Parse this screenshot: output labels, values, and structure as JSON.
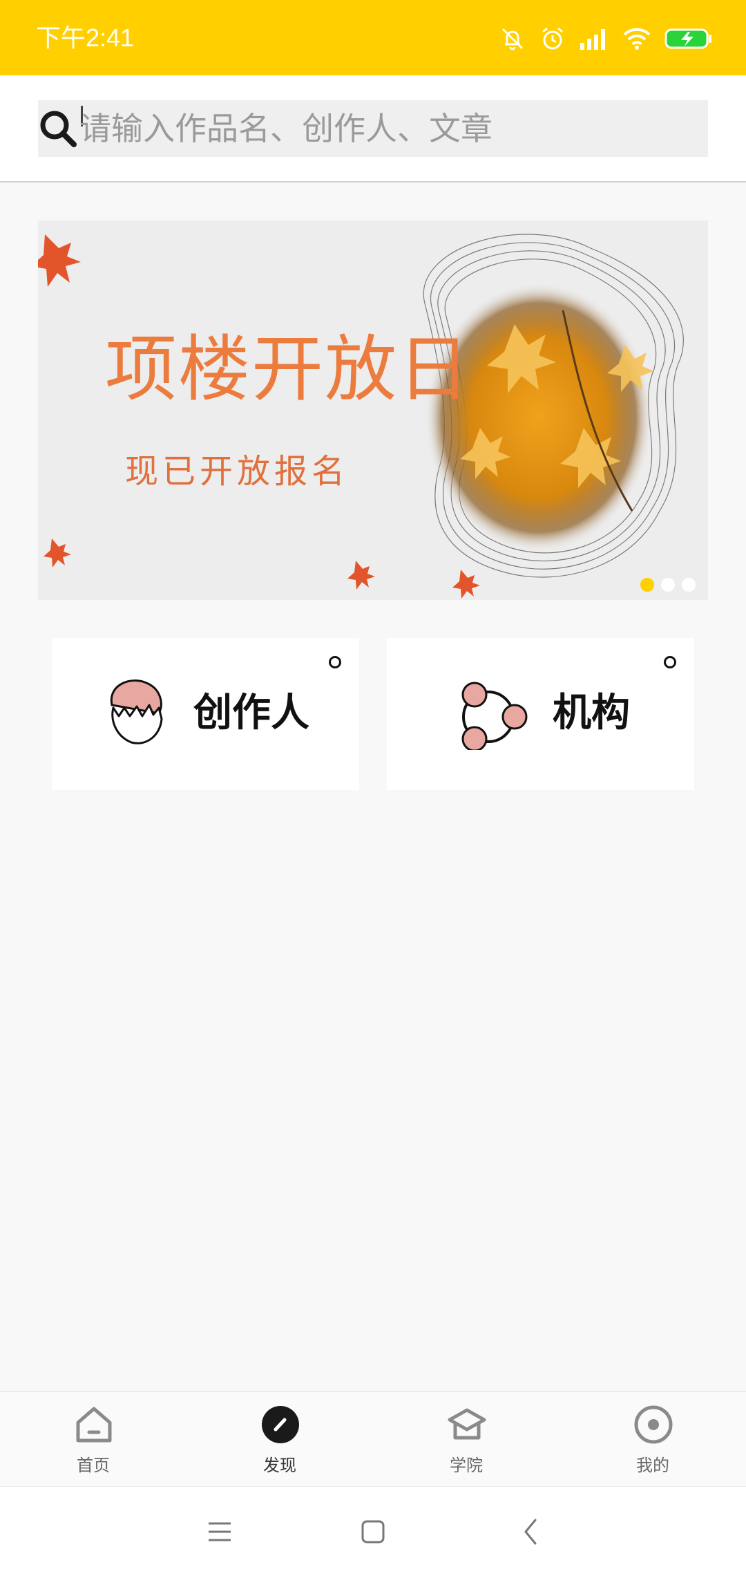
{
  "status_bar": {
    "time": "下午2:41",
    "icons": [
      "mute-bell-icon",
      "alarm-icon",
      "signal-icon",
      "wifi-icon",
      "battery-charging-icon"
    ],
    "background": "#ffcf00"
  },
  "search": {
    "placeholder": "请输入作品名、创作人、文章",
    "value": ""
  },
  "banner": {
    "title": "项楼开放日",
    "subtitle": "现已开放报名",
    "active_slide": 1,
    "slide_count": 3,
    "accent": "#ffcf00"
  },
  "categories": [
    {
      "label": "创作人",
      "icon": "creator-face-icon"
    },
    {
      "label": "机构",
      "icon": "organization-network-icon"
    }
  ],
  "tabbar": {
    "items": [
      {
        "label": "首页",
        "icon": "home-icon"
      },
      {
        "label": "发现",
        "icon": "discover-icon",
        "active": true
      },
      {
        "label": "学院",
        "icon": "academy-icon"
      },
      {
        "label": "我的",
        "icon": "profile-icon"
      }
    ]
  },
  "navbar": {
    "items": [
      "menu-icon",
      "home-square-icon",
      "back-icon"
    ]
  }
}
